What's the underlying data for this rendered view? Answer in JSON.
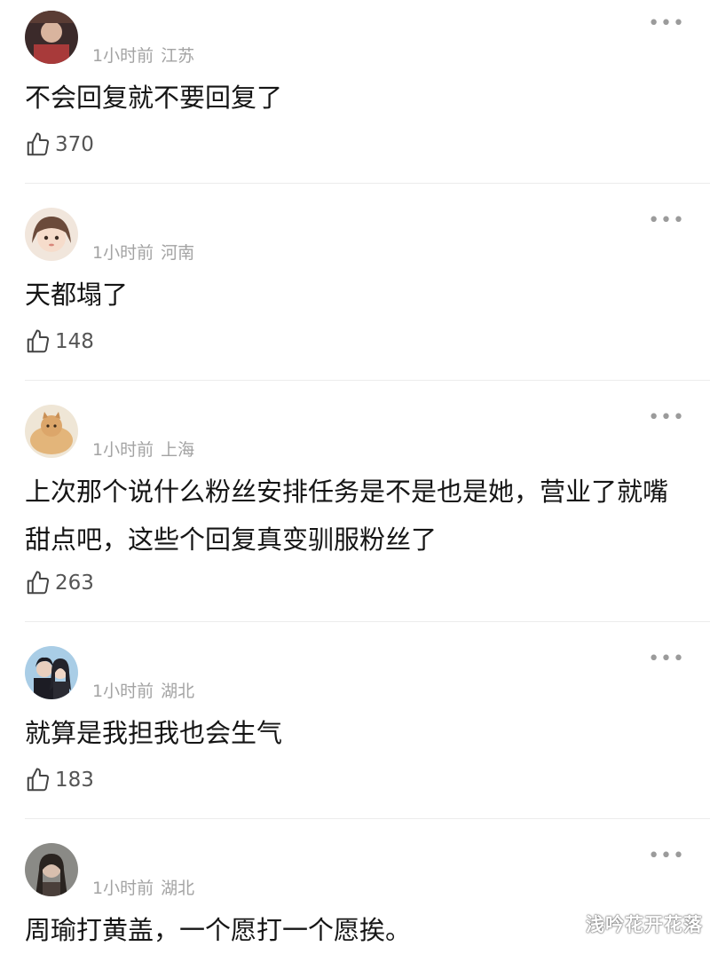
{
  "comments": [
    {
      "time": "1小时前",
      "location": "江苏",
      "text": "不会回复就不要回复了",
      "likes": "370",
      "more_icon": "more-dots-icon",
      "avatar_colors": [
        "#3b2a2a",
        "#a83a3a"
      ]
    },
    {
      "time": "1小时前",
      "location": "河南",
      "text": "天都塌了",
      "likes": "148",
      "more_icon": "more-dots-icon",
      "avatar_colors": [
        "#f1d9c7",
        "#6b4a3a"
      ]
    },
    {
      "time": "1小时前",
      "location": "上海",
      "text": "上次那个说什么粉丝安排任务是不是也是她，营业了就嘴甜点吧，这些个回复真变驯服粉丝了",
      "likes": "263",
      "more_icon": "more-dots-icon",
      "avatar_colors": [
        "#efe6d6",
        "#d9a66a"
      ]
    },
    {
      "time": "1小时前",
      "location": "湖北",
      "text": "就算是我担我也会生气",
      "likes": "183",
      "more_icon": "more-dots-icon",
      "avatar_colors": [
        "#a9cde6",
        "#1c1c24"
      ]
    },
    {
      "time": "1小时前",
      "location": "湖北",
      "text": "周瑜打黄盖，一个愿打一个愿挨。",
      "likes": "",
      "more_icon": "more-dots-icon",
      "avatar_colors": [
        "#8a8a86",
        "#2a2420"
      ]
    }
  ],
  "like_icon": "thumbs-up-icon",
  "watermark": "浅吟花开花落"
}
